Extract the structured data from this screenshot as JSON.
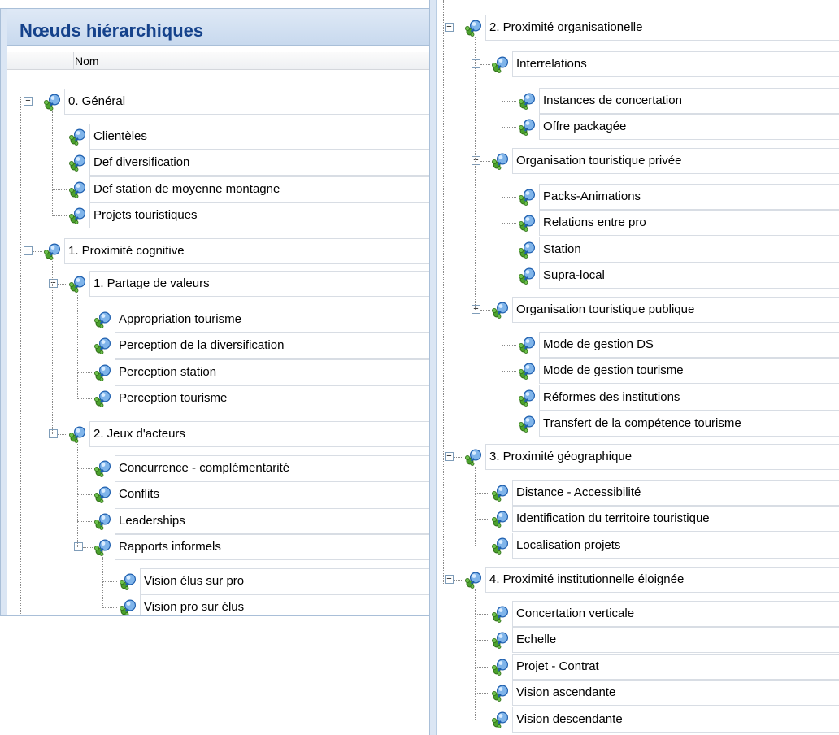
{
  "panel": {
    "title": "Nœuds hiérarchiques",
    "column_header": "Nom"
  },
  "left_nodes": [
    {
      "label": "0. Général",
      "expanded": true
    },
    {
      "label": "Clientèles"
    },
    {
      "label": "Def diversification"
    },
    {
      "label": "Def station de moyenne montagne"
    },
    {
      "label": "Projets touristiques"
    },
    {
      "label": "1. Proximité cognitive",
      "expanded": true
    },
    {
      "label": "1. Partage de valeurs",
      "expanded": true
    },
    {
      "label": "Appropriation tourisme"
    },
    {
      "label": "Perception de la diversification"
    },
    {
      "label": "Perception station"
    },
    {
      "label": "Perception tourisme"
    },
    {
      "label": "2. Jeux d'acteurs",
      "expanded": true
    },
    {
      "label": "Concurrence - complémentarité"
    },
    {
      "label": "Conflits"
    },
    {
      "label": "Leaderships"
    },
    {
      "label": "Rapports informels",
      "expanded": true
    },
    {
      "label": "Vision élus sur pro"
    },
    {
      "label": "Vision pro sur élus"
    }
  ],
  "right_nodes": [
    {
      "label": "2. Proximité organisationelle",
      "expanded": true
    },
    {
      "label": "Interrelations",
      "expanded": true
    },
    {
      "label": "Instances de concertation"
    },
    {
      "label": "Offre packagée"
    },
    {
      "label": "Organisation touristique privée",
      "expanded": true
    },
    {
      "label": "Packs-Animations"
    },
    {
      "label": "Relations entre pro"
    },
    {
      "label": "Station"
    },
    {
      "label": "Supra-local"
    },
    {
      "label": "Organisation touristique publique",
      "expanded": true
    },
    {
      "label": "Mode de gestion DS"
    },
    {
      "label": "Mode de gestion tourisme"
    },
    {
      "label": "Réformes des institutions"
    },
    {
      "label": "Transfert de la compétence tourisme"
    },
    {
      "label": "3. Proximité géographique",
      "expanded": true
    },
    {
      "label": "Distance - Accessibilité"
    },
    {
      "label": "Identification du territoire touristique"
    },
    {
      "label": "Localisation projets"
    },
    {
      "label": "4. Proximité institutionnelle éloignée",
      "expanded": true
    },
    {
      "label": "Concertation verticale"
    },
    {
      "label": "Echelle"
    },
    {
      "label": "Projet - Contrat"
    },
    {
      "label": "Vision ascendante"
    },
    {
      "label": "Vision descendante"
    }
  ],
  "icons": {
    "node": "node-network-icon",
    "expander": "minus-box-icon"
  },
  "colors": {
    "title_text": "#15428b",
    "header_bg": "#c8d9ee",
    "border": "#a9bfd8"
  }
}
